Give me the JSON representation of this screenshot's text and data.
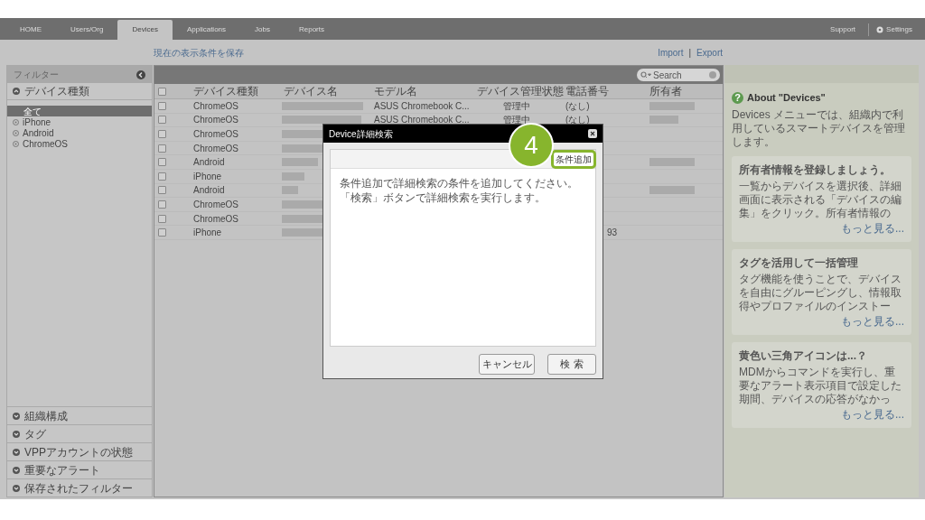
{
  "nav": {
    "tabs": [
      {
        "label": "HOME",
        "selected": false
      },
      {
        "label": "Users/Org",
        "selected": false
      },
      {
        "label": "Devices",
        "selected": true
      },
      {
        "label": "Applications",
        "selected": false
      },
      {
        "label": "Jobs",
        "selected": false
      },
      {
        "label": "Reports",
        "selected": false
      }
    ],
    "support": "Support",
    "settings": "Settings"
  },
  "toolbar": {
    "save_link": "現在の表示条件を保存",
    "import": "Import",
    "separator": "|",
    "export": "Export"
  },
  "sidebar": {
    "title": "フィルター",
    "section": {
      "label": "デバイス種類",
      "expanded": true,
      "items": [
        {
          "label": "全て",
          "selected": true
        },
        {
          "label": "iPhone",
          "selected": false
        },
        {
          "label": "Android",
          "selected": false
        },
        {
          "label": "ChromeOS",
          "selected": false
        }
      ]
    },
    "collapsed_sections": [
      {
        "label": "組織構成",
        "expanded": false
      },
      {
        "label": "タグ",
        "expanded": false
      },
      {
        "label": "VPPアカウントの状態",
        "expanded": false
      },
      {
        "label": "重要なアラート",
        "expanded": false
      },
      {
        "label": "保存されたフィルター",
        "expanded": false
      }
    ]
  },
  "table": {
    "search": {
      "placeholder": "Search"
    },
    "select_all_checked": false,
    "columns": [
      "デバイス種類",
      "デバイス名",
      "モデル名",
      "デバイス管理状態",
      "電話番号",
      "所有者"
    ],
    "rows": [
      {
        "checked": false,
        "type": "ChromeOS",
        "model": "ASUS Chromebook C...",
        "status": "管理中",
        "phone": "(なし)",
        "phone_partial": false,
        "owner_redacted": true
      },
      {
        "checked": false,
        "type": "ChromeOS",
        "model": "ASUS Chromebook C...",
        "status": "管理中",
        "phone": "(なし)",
        "phone_partial": false,
        "owner_redacted": true
      },
      {
        "checked": false,
        "type": "ChromeOS",
        "owner_redacted": false
      },
      {
        "checked": false,
        "type": "ChromeOS",
        "owner_redacted": false
      },
      {
        "checked": false,
        "type": "Android",
        "owner_redacted": true
      },
      {
        "checked": false,
        "type": "iPhone",
        "owner_redacted": false
      },
      {
        "checked": false,
        "type": "Android",
        "owner_redacted": true
      },
      {
        "checked": false,
        "type": "ChromeOS",
        "owner_redacted": false
      },
      {
        "checked": false,
        "type": "ChromeOS",
        "owner_redacted": false
      },
      {
        "checked": false,
        "type": "iPhone",
        "phone": "93",
        "phone_partial": true,
        "owner_redacted": false
      }
    ]
  },
  "dialog": {
    "title": "Device詳細検索",
    "add_button": {
      "label": "条件追加",
      "highlighted": true
    },
    "callout": "4",
    "message": [
      "条件追加で詳細検索の条件を追加してください。",
      "「検索」ボタンで詳細検索を実行します。"
    ],
    "cancel": "キャンセル",
    "search": "検 索"
  },
  "help": {
    "icon": "?",
    "title": "About \"Devices\"",
    "text": "Devices メニューでは、組織内で利用しているスマートデバイスを管理します。",
    "cards": [
      {
        "title": "所有者情報を登録しましょう。",
        "text": "一覧からデバイスを選択後、詳細画面に表示される「デバイスの編集」をクリック。所有者情報の",
        "more": "もっと見る..."
      },
      {
        "title": "タグを活用して一括管理",
        "text": "タグ機能を使うことで、デバイスを自由にグルーピングし、情報取得やプロファイルのインストー",
        "more": "もっと見る..."
      },
      {
        "title": "黄色い三角アイコンは...？",
        "text": "MDMからコマンドを実行し、重要なアラート表示項目で設定した期間、デバイスの応答がなかっ",
        "more": "もっと見る..."
      }
    ]
  }
}
